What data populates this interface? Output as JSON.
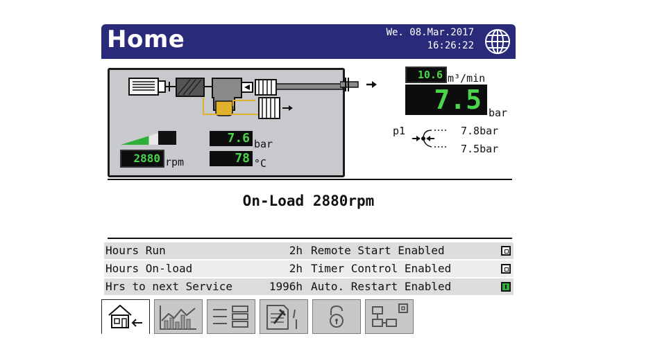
{
  "header": {
    "title": "Home",
    "date": "We. 08.Mar.2017",
    "time": "16:26:22",
    "icon": "globe-icon"
  },
  "plant": {
    "speed_display": "2880",
    "speed_unit": "rpm",
    "pressure_display": "7.6",
    "pressure_unit": "bar",
    "temperature_display": "78",
    "temperature_unit": "°C",
    "speed_level_fraction": 0.75
  },
  "outlet": {
    "flow_display": "10.6",
    "flow_unit": "m³/min",
    "pressure_display": "7.5",
    "pressure_unit": "bar",
    "p1_label": "p1",
    "p1_upper": "7.8bar",
    "p1_lower": "7.5bar"
  },
  "status": {
    "text": "On-Load 2880rpm"
  },
  "info_left": [
    {
      "label": "Hours Run",
      "value": "2h"
    },
    {
      "label": "Hours On-load",
      "value": "2h"
    },
    {
      "label": "Hrs to next Service",
      "value": "1996h"
    }
  ],
  "info_right": [
    {
      "label": "Remote Start Enabled",
      "indicator": "off"
    },
    {
      "label": "Timer Control Enabled",
      "indicator": "off"
    },
    {
      "label": "Auto. Restart Enabled",
      "indicator": "on"
    }
  ],
  "colors": {
    "header_bg": "#2a2a7a",
    "lcd_text": "#4cd44c",
    "indicator_on": "#2fae3a",
    "pipe_oil": "#e0b12a"
  },
  "tabs": [
    {
      "icon": "home-icon",
      "active": true
    },
    {
      "icon": "trend-chart-icon",
      "active": false
    },
    {
      "icon": "list-icon",
      "active": false
    },
    {
      "icon": "service-icon",
      "active": false
    },
    {
      "icon": "lock-icon",
      "active": false
    },
    {
      "icon": "network-icon",
      "active": false
    }
  ]
}
